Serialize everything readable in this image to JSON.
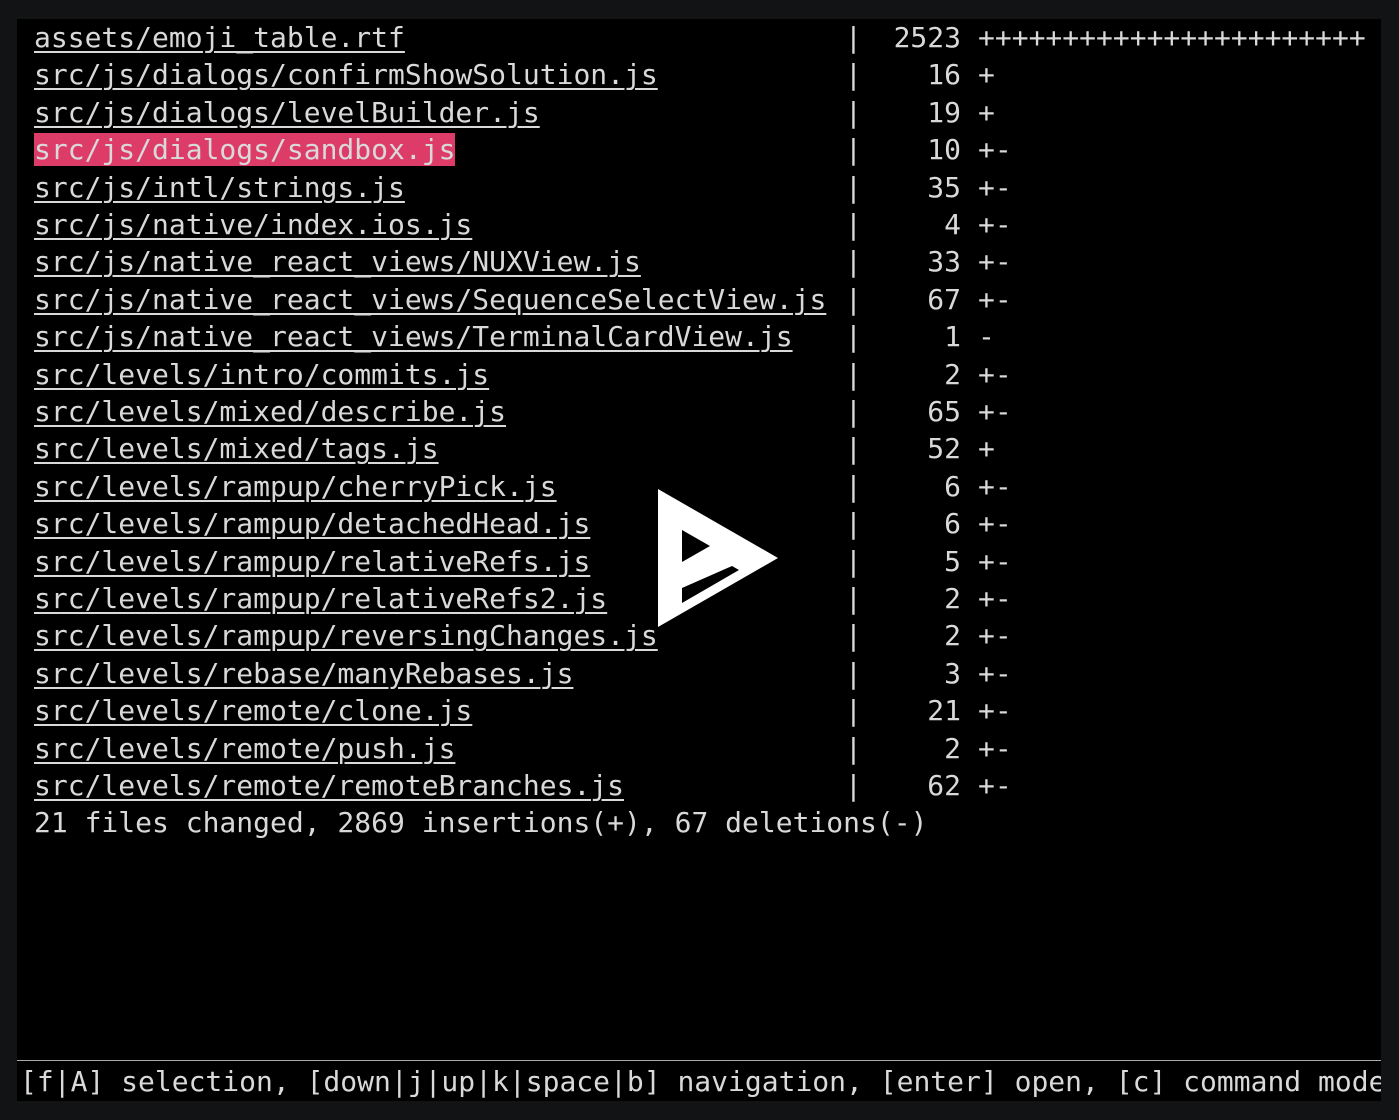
{
  "diffstat": {
    "files": [
      {
        "path": "assets/emoji_table.rtf",
        "changes": "2523",
        "graph": "+++++++++++++++++++++++",
        "selected": false
      },
      {
        "path": "src/js/dialogs/confirmShowSolution.js",
        "changes": "16",
        "graph": "+",
        "selected": false
      },
      {
        "path": "src/js/dialogs/levelBuilder.js",
        "changes": "19",
        "graph": "+",
        "selected": false
      },
      {
        "path": "src/js/dialogs/sandbox.js",
        "changes": "10",
        "graph": "+-",
        "selected": true
      },
      {
        "path": "src/js/intl/strings.js",
        "changes": "35",
        "graph": "+-",
        "selected": false
      },
      {
        "path": "src/js/native/index.ios.js",
        "changes": "4",
        "graph": "+-",
        "selected": false
      },
      {
        "path": "src/js/native_react_views/NUXView.js",
        "changes": "33",
        "graph": "+-",
        "selected": false
      },
      {
        "path": "src/js/native_react_views/SequenceSelectView.js",
        "changes": "67",
        "graph": "+-",
        "selected": false
      },
      {
        "path": "src/js/native_react_views/TerminalCardView.js",
        "changes": "1",
        "graph": "-",
        "selected": false
      },
      {
        "path": "src/levels/intro/commits.js",
        "changes": "2",
        "graph": "+-",
        "selected": false
      },
      {
        "path": "src/levels/mixed/describe.js",
        "changes": "65",
        "graph": "+-",
        "selected": false
      },
      {
        "path": "src/levels/mixed/tags.js",
        "changes": "52",
        "graph": "+",
        "selected": false
      },
      {
        "path": "src/levels/rampup/cherryPick.js",
        "changes": "6",
        "graph": "+-",
        "selected": false
      },
      {
        "path": "src/levels/rampup/detachedHead.js",
        "changes": "6",
        "graph": "+-",
        "selected": false
      },
      {
        "path": "src/levels/rampup/relativeRefs.js",
        "changes": "5",
        "graph": "+-",
        "selected": false
      },
      {
        "path": "src/levels/rampup/relativeRefs2.js",
        "changes": "2",
        "graph": "+-",
        "selected": false
      },
      {
        "path": "src/levels/rampup/reversingChanges.js",
        "changes": "2",
        "graph": "+-",
        "selected": false
      },
      {
        "path": "src/levels/rebase/manyRebases.js",
        "changes": "3",
        "graph": "+-",
        "selected": false
      },
      {
        "path": "src/levels/remote/clone.js",
        "changes": "21",
        "graph": "+-",
        "selected": false
      },
      {
        "path": "src/levels/remote/push.js",
        "changes": "2",
        "graph": "+-",
        "selected": false
      },
      {
        "path": "src/levels/remote/remoteBranches.js",
        "changes": "62",
        "graph": "+-",
        "selected": false
      }
    ],
    "separator": "|",
    "summary": "21 files changed, 2869 insertions(+), 67 deletions(-)"
  },
  "statusbar": {
    "text": "[f|A] selection, [down|j|up|k|space|b] navigation, [enter] open, [c] command mode"
  },
  "overlay": {
    "icon": "asciinema-play-icon"
  },
  "colors": {
    "selection": "#dd3c69",
    "background": "#000000",
    "foreground": "#d9d9d9"
  }
}
